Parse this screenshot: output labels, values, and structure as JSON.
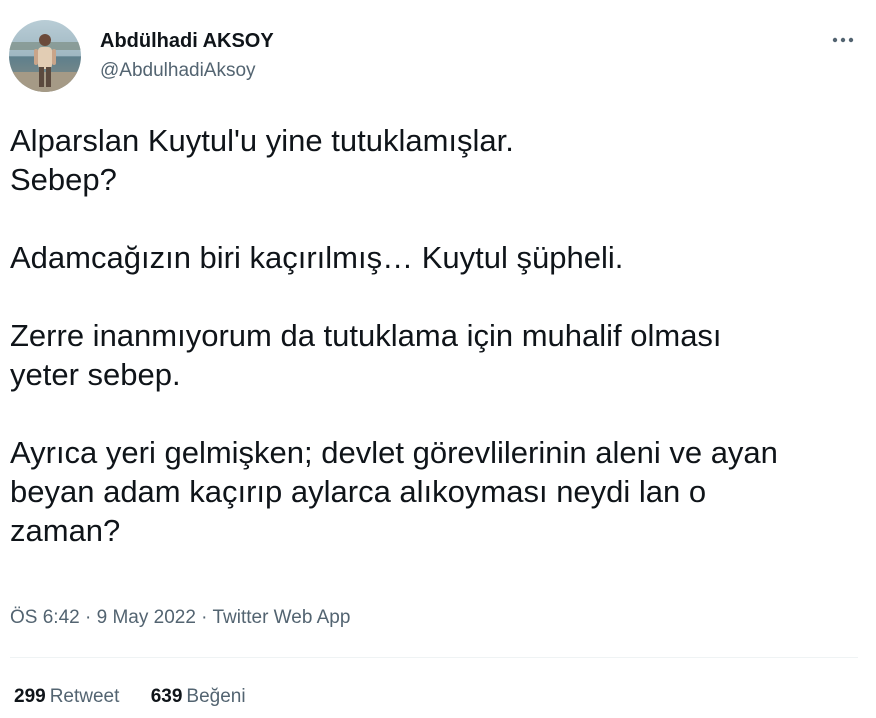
{
  "author": {
    "display_name": "Abdülhadi AKSOY",
    "handle": "@AbdulhadiAksoy"
  },
  "more_icon": "three-dots-horizontal-icon",
  "tweet": {
    "paragraphs": [
      [
        "Alparslan Kuytul'u yine tutuklamışlar.",
        "Sebep?"
      ],
      [
        "Adamcağızın biri kaçırılmış… Kuytul şüpheli."
      ],
      [
        "Zerre inanmıyorum da tutuklama için muhalif olması",
        "yeter sebep."
      ],
      [
        "Ayrıca yeri gelmişken; devlet görevlilerinin aleni ve ayan",
        "beyan adam kaçırıp aylarca alıkoyması neydi lan o",
        "zaman?"
      ]
    ]
  },
  "meta": {
    "time": "ÖS 6:42",
    "sep1": " · ",
    "date": "9 May 2022",
    "sep2": " · ",
    "source": "Twitter Web App"
  },
  "stats": {
    "retweets_count": "299",
    "retweets_label": "Retweet",
    "likes_count": "639",
    "likes_label": "Beğeni"
  },
  "colors": {
    "text_primary": "#0f1419",
    "text_secondary": "#536471",
    "divider": "#eff3f4"
  }
}
